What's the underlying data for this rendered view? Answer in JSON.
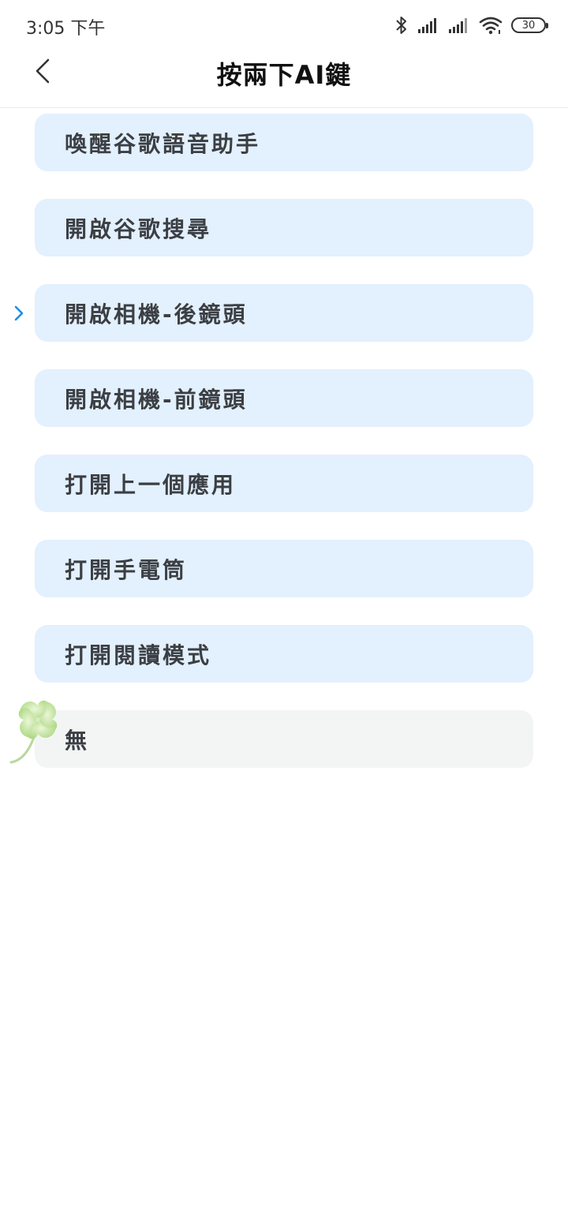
{
  "status_bar": {
    "time": "3:05 下午",
    "battery": "30"
  },
  "header": {
    "title": "按兩下AI鍵"
  },
  "options": [
    {
      "label": "喚醒谷歌語音助手"
    },
    {
      "label": "開啟谷歌搜尋"
    },
    {
      "label": "開啟相機-後鏡頭",
      "selected": true
    },
    {
      "label": "開啟相機-前鏡頭"
    },
    {
      "label": "打開上一個應用"
    },
    {
      "label": "打開手電筒"
    },
    {
      "label": "打開閱讀模式"
    },
    {
      "label": "無"
    }
  ],
  "colors": {
    "option_background": "#e3f0fd",
    "none_option_background": "#f3f5f5",
    "selected_indicator": "#1a8fe8"
  },
  "icons": {
    "back": "chevron-left-icon",
    "selected": "chevron-right-icon",
    "bluetooth": "bluetooth-icon",
    "signal": "signal-icon",
    "wifi": "wifi-icon",
    "battery": "battery-icon",
    "clover": "clover-icon"
  }
}
